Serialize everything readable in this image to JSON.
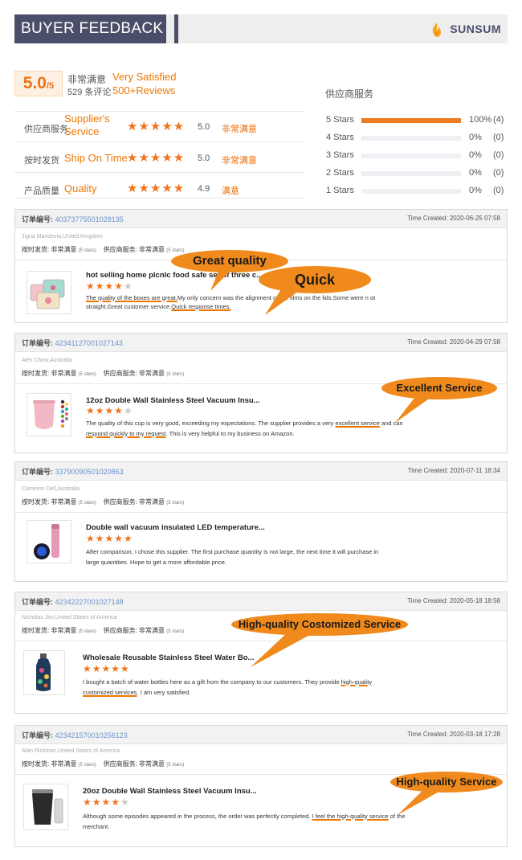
{
  "header": {
    "title": "BUYER FEEDBACK",
    "brand": "SUNSUM"
  },
  "rating": {
    "score": "5.0",
    "score_max": "/5",
    "level_zh": "非常满意",
    "level_en": "Very Satisfied",
    "count_zh": "529 条评论",
    "count_en": "500+Reviews",
    "dist_title": "供应商服务",
    "criteria": [
      {
        "zh": "供应商服务",
        "en": "Supplier's Service",
        "stars": 5,
        "value": "5.0",
        "level": "非常满意"
      },
      {
        "zh": "按时发货",
        "en": "Ship On Time",
        "stars": 5,
        "value": "5.0",
        "level": "非常满意"
      },
      {
        "zh": "产品质量",
        "en": "Quality",
        "stars": 5,
        "value": "4.9",
        "level": "满意"
      }
    ],
    "distribution": [
      {
        "label": "5 Stars",
        "percent": "100%",
        "count": "(4)",
        "fill": 1.0
      },
      {
        "label": "4 Stars",
        "percent": "0%",
        "count": "(0)",
        "fill": 0
      },
      {
        "label": "3 Stars",
        "percent": "0%",
        "count": "(0)",
        "fill": 0
      },
      {
        "label": "2 Stars",
        "percent": "0%",
        "count": "(0)",
        "fill": 0
      },
      {
        "label": "1 Stars",
        "percent": "0%",
        "count": "(0)",
        "fill": 0
      }
    ]
  },
  "order_label": "订单编号:",
  "time_label": "Time Created:",
  "tag_ship": "按时发货: 非常满意",
  "tag_supplier": "供应商服务: 非常满意",
  "tag_stars": "(5 stars)",
  "orders": [
    {
      "order_no": "40373775501028135",
      "time": "2020-06-25 07:58",
      "buyer": "Jigna Mandevia,United Kingdom",
      "product": "hot selling home plcnlc food safe set of three c...",
      "stars": 4,
      "text_a": "The quality of the boxes are great.",
      "text_b": "My only concern was the alignment of the films on the lids.Some were n ot straight.Great customer service.",
      "text_c": "Quick response times."
    },
    {
      "order_no": "42341127001027143",
      "time": "2020-04-29 07:58",
      "buyer": "Alex Chow,Australia",
      "product": "12oz Double Wall Stainless Steel Vacuum Insu...",
      "stars": 4,
      "text_a": "The quality of this cup is very good, exceeding my expectations. The supplier provides a very ",
      "text_b": "excellent service",
      "text_c": " and can ",
      "text_d": "respond quickly to my request",
      "text_e": ". This is very helpful to my business on Amazon."
    },
    {
      "order_no": "33790090501020863",
      "time": "2020-07-11 18:34",
      "buyer": "Cameron Dell,Australia",
      "product": "Double wall vacuum insulated LED temperature...",
      "stars": 5,
      "text_a": "After comparison, I chose this supplier. The first purchase quantity is not large, the next time it will purchase in large quantities. Hope to get a more affordable price."
    },
    {
      "order_no": "42342227001027148",
      "time": "2020-05-18 18:58",
      "buyer": "Nicholas Jim,United States of America",
      "product": "Wholesale Reusable Stainless Steel Water Bo...",
      "stars": 5,
      "text_a": "I bought a batch of water bottles here as a gift from the company to our customers. They provide ",
      "text_b": "high-quality customized services",
      "text_c": ". I am very satisfied."
    },
    {
      "order_no": "423421570010256123",
      "time": "2020-03-18 17:28",
      "buyer": "Alan Rickman,United States of America",
      "product": "20oz Double Wall Stainless Steel Vacuum Insu...",
      "stars": 4,
      "text_a": "Although some episodes appeared in the process, the order was perfectly completed. ",
      "text_b": "I feel the high-quality service",
      "text_c": " of the merchant."
    }
  ],
  "callouts": {
    "great_quality": "Great quality",
    "quick": "Quick",
    "excellent_service": "Excellent Service",
    "customized_service": "High-quality Costomized Service",
    "high_quality_service": "High-quality Service"
  },
  "colors": {
    "accent": "#f08a1c",
    "header": "#4a4e69",
    "link": "#6b93c9"
  }
}
